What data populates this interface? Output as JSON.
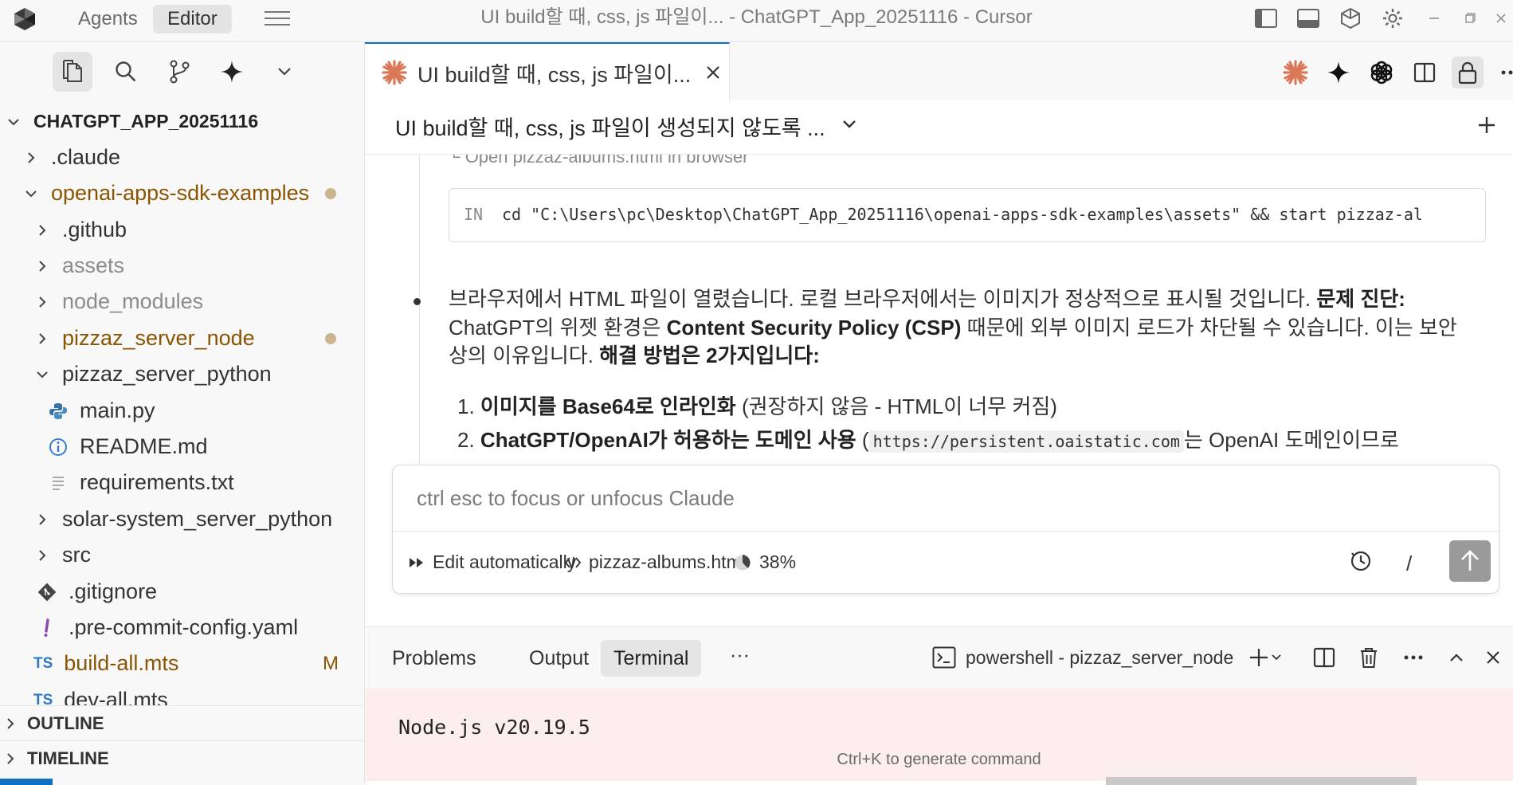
{
  "titlebar": {
    "tabs": [
      "Agents",
      "Editor"
    ],
    "active_tab": "Editor",
    "title": "UI build할 때, css, js 파일이... - ChatGPT_App_20251116 - Cursor"
  },
  "explorer": {
    "root": "CHATGPT_APP_20251116",
    "items": [
      {
        "label": ".claude",
        "kind": "folder",
        "state": "collapsed"
      },
      {
        "label": "openai-apps-sdk-examples",
        "kind": "folder",
        "state": "expanded",
        "decoration": "modified-dot"
      },
      {
        "label": ".github",
        "kind": "folder",
        "state": "collapsed"
      },
      {
        "label": "assets",
        "kind": "folder",
        "state": "collapsed",
        "dimmed": true
      },
      {
        "label": "node_modules",
        "kind": "folder",
        "state": "collapsed",
        "dimmed": true
      },
      {
        "label": "pizzaz_server_node",
        "kind": "folder",
        "state": "collapsed",
        "decoration": "modified-dot"
      },
      {
        "label": "pizzaz_server_python",
        "kind": "folder",
        "state": "expanded"
      },
      {
        "label": "main.py",
        "kind": "file",
        "icon": "python-icon"
      },
      {
        "label": "README.md",
        "kind": "file",
        "icon": "info-icon"
      },
      {
        "label": "requirements.txt",
        "kind": "file",
        "icon": "text-file-icon"
      },
      {
        "label": "solar-system_server_python",
        "kind": "folder",
        "state": "collapsed"
      },
      {
        "label": "src",
        "kind": "folder",
        "state": "collapsed"
      },
      {
        "label": ".gitignore",
        "kind": "file",
        "icon": "git-icon"
      },
      {
        "label": ".pre-commit-config.yaml",
        "kind": "file",
        "icon": "exclamation-icon"
      },
      {
        "label": "build-all.mts",
        "kind": "file",
        "icon": "ts-icon",
        "badge": "M"
      },
      {
        "label": "dev-all.mts",
        "kind": "file",
        "icon": "ts-icon"
      }
    ],
    "ts_label": "TS",
    "outline": "OUTLINE",
    "timeline": "TIMELINE"
  },
  "editor_tab": {
    "label": "UI build할 때, css, js 파일이..."
  },
  "chat": {
    "title": "UI build할 때, css, js 파일이 생성되지 않도록 ...",
    "step_label": "└ Open pizzaz-albums.html in browser",
    "code_prefix": "IN",
    "code_cmd": "cd \"C:\\Users\\pc\\Desktop\\ChatGPT_App_20251116\\openai-apps-sdk-examples\\assets\" && start pizzaz-al",
    "para1_a": "브라우저에서 HTML 파일이 열렸습니다. 로컬 브라우저에서는 이미지가 정상적으로 표시될 것입니다. ",
    "para1_b": "문제 진단:",
    "para2_a": "ChatGPT의 위젯 환경은 ",
    "para2_b": "Content Security Policy (CSP)",
    "para2_c": " 때문에 외부 이미지 로드가 차단될 수 있습니다. 이는 보안",
    "para3_a": "상의 이유입니다. ",
    "para3_b": "해결 방법은 2가지입니다:",
    "li1_num": "1. ",
    "li1_b": "이미지를 Base64로 인라인화",
    "li1_rest": " (권장하지 않음 - HTML이 너무 커짐)",
    "li2_num": "2. ",
    "li2_b": "ChatGPT/OpenAI가 허용하는 도메인 사용",
    "li2_paren": " (",
    "li2_code": "https://persistent.oaistatic.com",
    "li2_rest": "는 OpenAI 도메인이므로"
  },
  "input": {
    "placeholder": "ctrl esc to focus or unfocus Claude",
    "mode": "Edit automatically",
    "file": "pizzaz-albums.html",
    "context": "38%",
    "slash": "/"
  },
  "panel": {
    "tabs": [
      "Problems",
      "Output",
      "Terminal"
    ],
    "active_tab": "Terminal",
    "more": "···",
    "terminal_name": "powershell - pizzaz_server_node",
    "terminal_line": "Node.js v20.19.5",
    "hint": "Ctrl+K to generate command"
  },
  "colors": {
    "accent": "#0f6fc5",
    "modified": "#895503",
    "claude": "#d97757",
    "terminal_bg": "#fdeeee"
  }
}
